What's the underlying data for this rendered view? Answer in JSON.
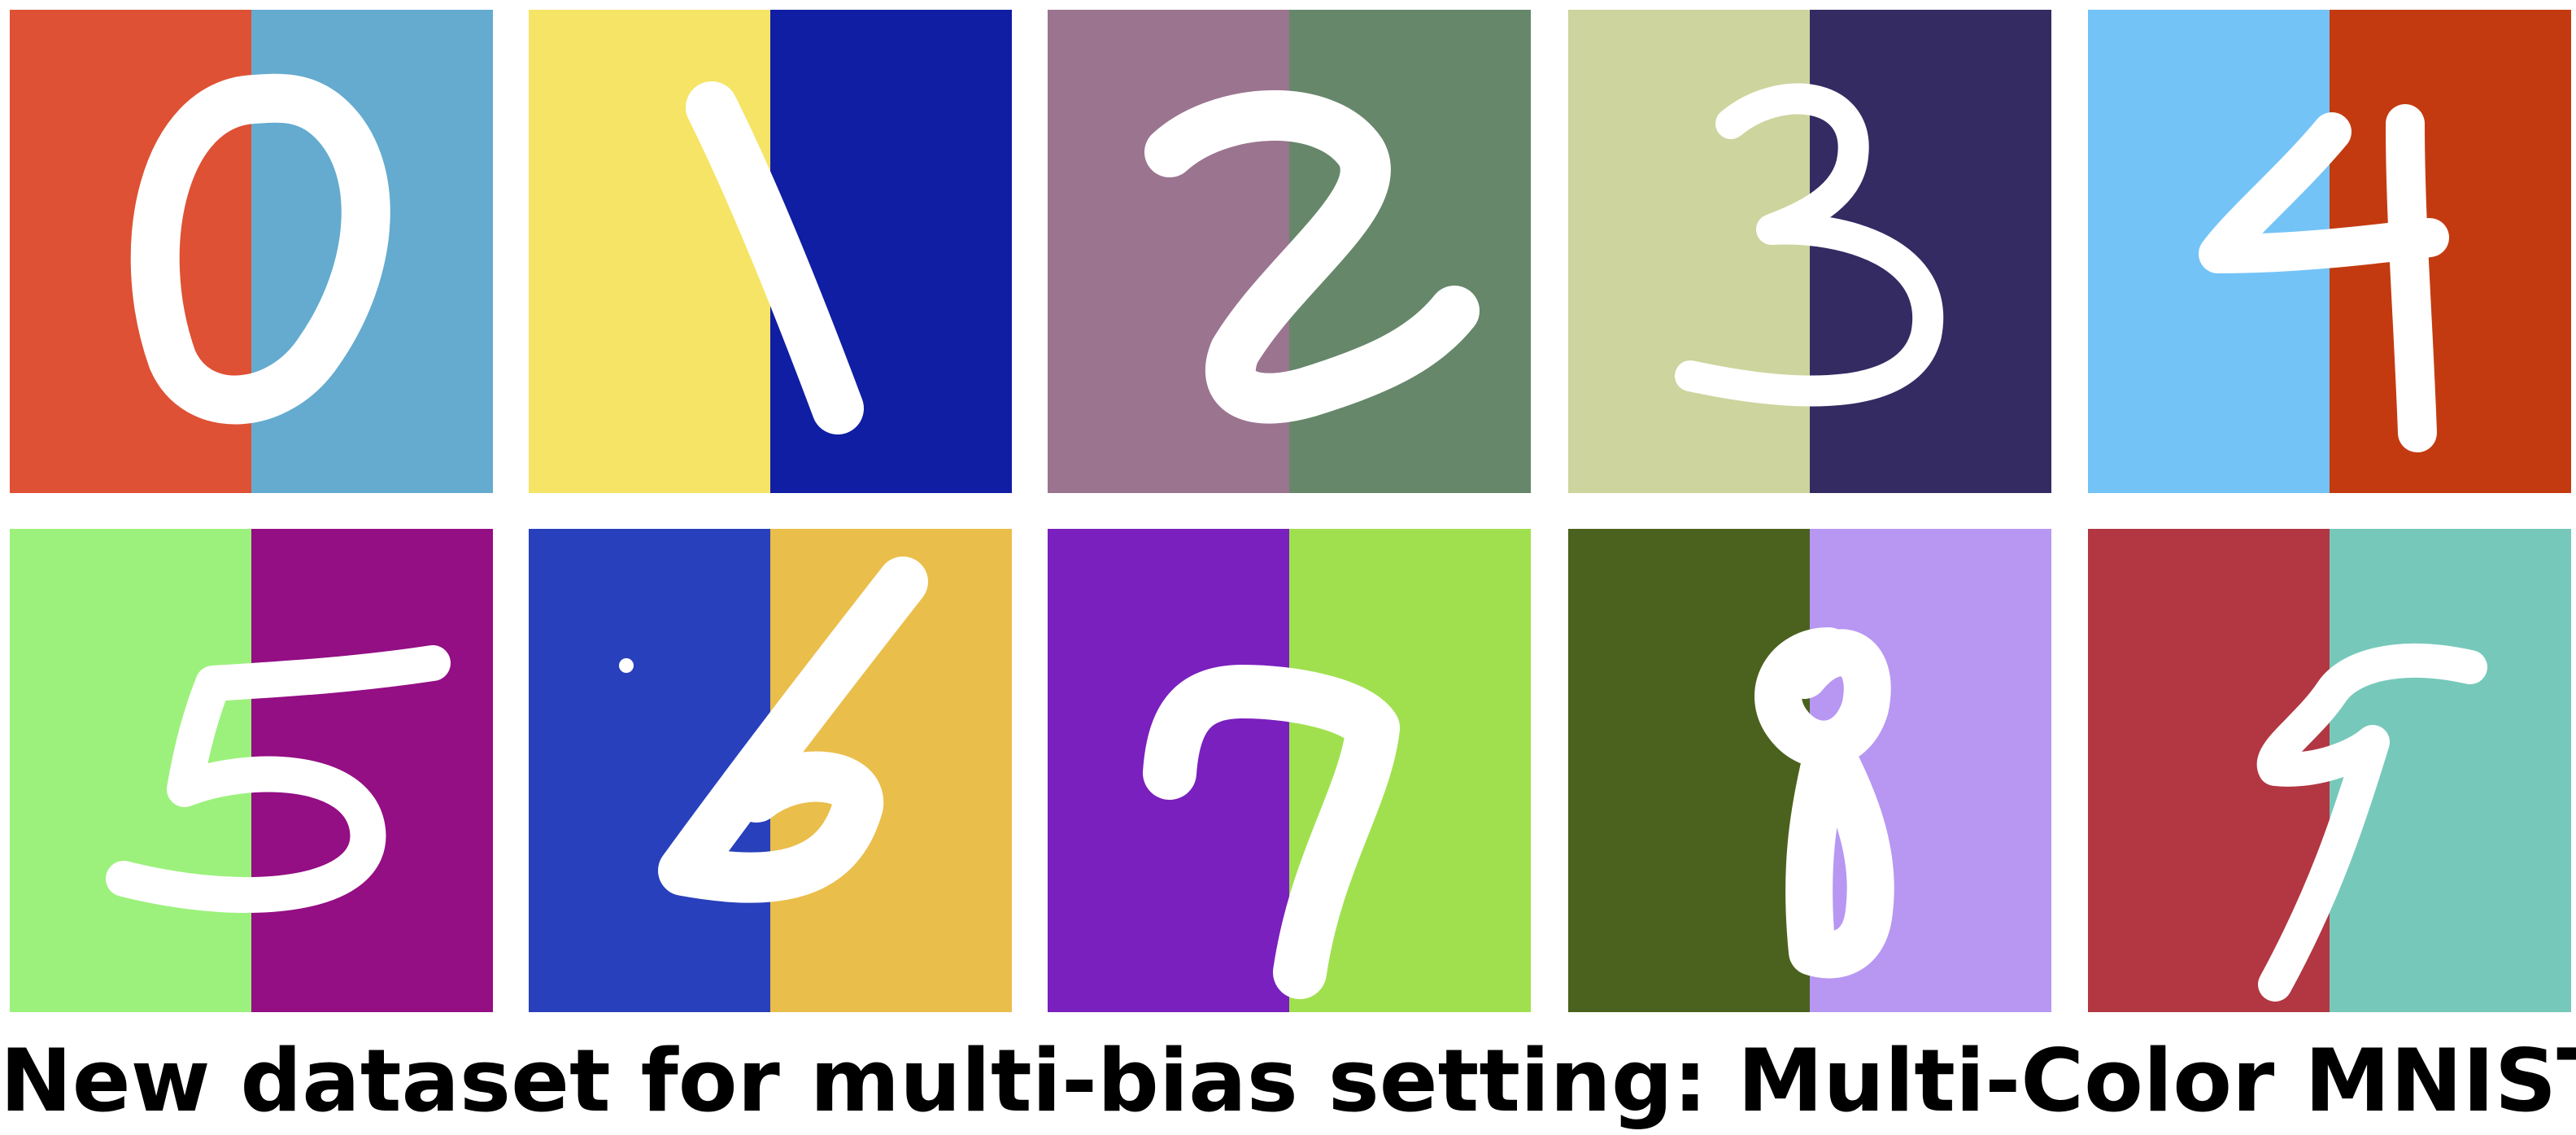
{
  "caption": "New dataset for multi-bias setting: Multi-Color MNIST",
  "tiles": [
    {
      "digit": "0",
      "left_color": "#DE5134",
      "right_color": "#64ABCF"
    },
    {
      "digit": "1",
      "left_color": "#F5E466",
      "right_color": "#101EA3"
    },
    {
      "digit": "2",
      "left_color": "#9B7490",
      "right_color": "#66876A"
    },
    {
      "digit": "3",
      "left_color": "#CDD49D",
      "right_color": "#342B63"
    },
    {
      "digit": "4",
      "left_color": "#73C3F7",
      "right_color": "#C43A10"
    },
    {
      "digit": "5",
      "left_color": "#9CF17C",
      "right_color": "#940E84"
    },
    {
      "digit": "6",
      "left_color": "#2840BC",
      "right_color": "#EABE4B"
    },
    {
      "digit": "7",
      "left_color": "#7A20BE",
      "right_color": "#A0E04F"
    },
    {
      "digit": "8",
      "left_color": "#4B621E",
      "right_color": "#B797F2"
    },
    {
      "digit": "9",
      "left_color": "#B23742",
      "right_color": "#76C9BA"
    }
  ]
}
